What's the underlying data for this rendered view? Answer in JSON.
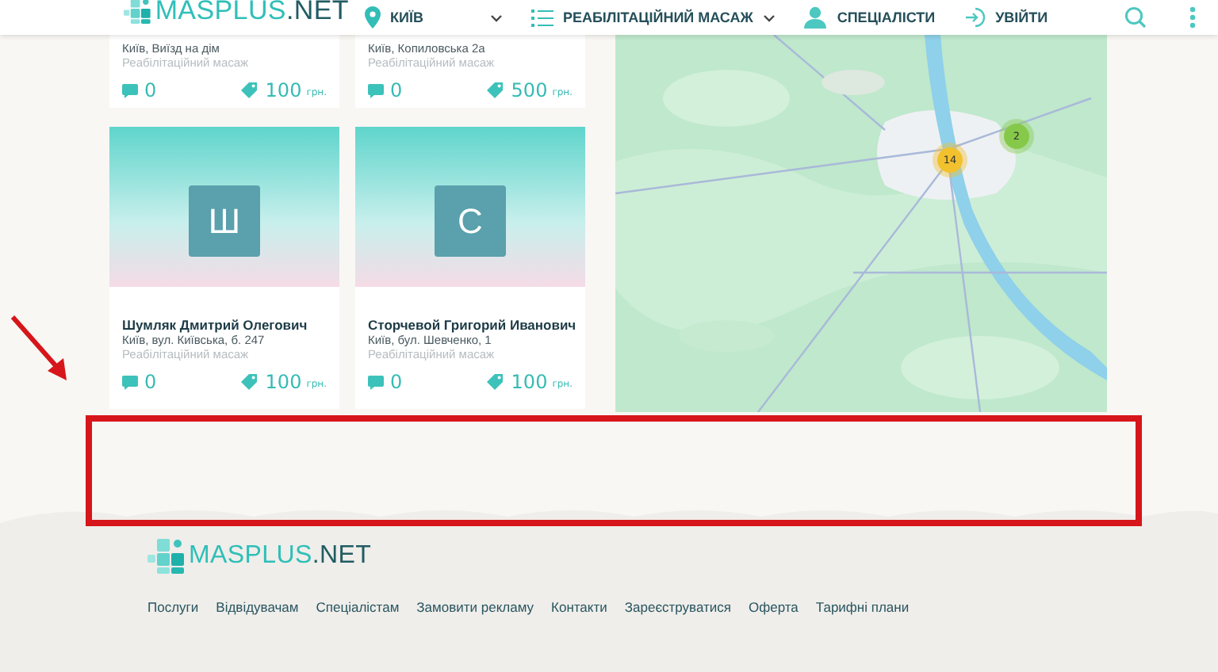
{
  "header": {
    "logo": {
      "name": "MASPLUS",
      "suffix": ".NET"
    },
    "city": "КИЇВ",
    "category": "РЕАБІЛІТАЦІЙНИЙ МАСАЖ",
    "specialists": "СПЕЦІАЛІСТИ",
    "login": "УВІЙТИ"
  },
  "cards": [
    {
      "kind": "cut",
      "address": "Київ, Виїзд на дім",
      "category": "Реабілітаційний масаж",
      "comments": "0",
      "price": "100",
      "currency": "грн."
    },
    {
      "kind": "cut",
      "address": "Київ, Копиловська 2а",
      "category": "Реабілітаційний масаж",
      "comments": "0",
      "price": "500",
      "currency": "грн."
    },
    {
      "kind": "full",
      "avatar": "Ш",
      "name": "Шумляк Дмитрий Олегович",
      "address": "Київ, вул. Київська, б. 247",
      "category": "Реабілітаційний масаж",
      "comments": "0",
      "price": "100",
      "currency": "грн."
    },
    {
      "kind": "full",
      "avatar": "С",
      "name": "Сторчевой Григорий Иванович",
      "address": "Київ, бул. Шевченко, 1",
      "category": "Реабілітаційний масаж",
      "comments": "0",
      "price": "100",
      "currency": "грн."
    }
  ],
  "map": {
    "markers": [
      {
        "count": "14",
        "color": "#f2c12e"
      },
      {
        "count": "2",
        "color": "#86c94a"
      }
    ]
  },
  "footer": {
    "logo": {
      "name": "MASPLUS",
      "suffix": ".NET"
    },
    "links": [
      "Послуги",
      "Відвідувачам",
      "Спеціалістам",
      "Замовити рекламу",
      "Контакти",
      "Зареєструватися",
      "Оферта",
      "Тарифні плани"
    ]
  }
}
